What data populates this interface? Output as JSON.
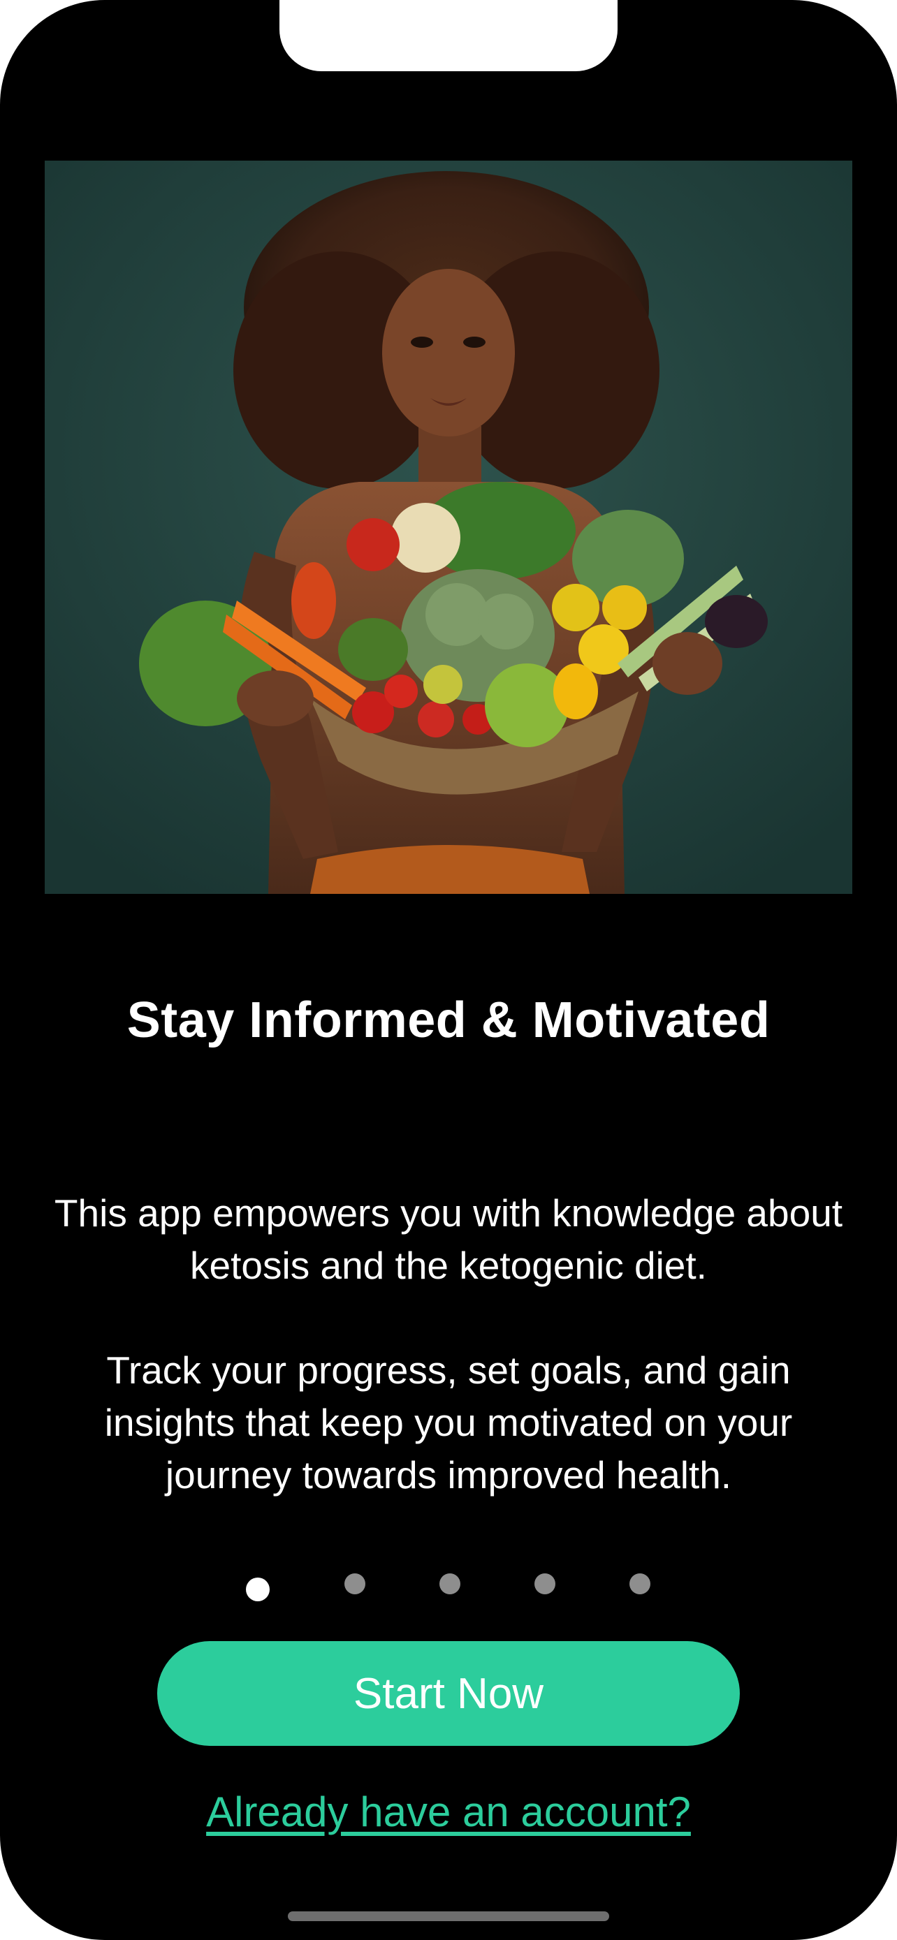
{
  "onboarding": {
    "title": "Stay Informed & Motivated",
    "paragraph_1": "This app empowers you with knowledge about ketosis and the ketogenic diet.",
    "paragraph_2": "Track your progress, set goals, and gain insights that keep you motivated on your journey towards improved health.",
    "page_count": 5,
    "active_page": 1,
    "start_button_label": "Start Now",
    "login_link_label": "Already have an account?"
  },
  "colors": {
    "background": "#000000",
    "accent": "#2ccd9c",
    "dot_inactive": "#8e8e8e",
    "dot_active": "#ffffff",
    "hero_backdrop": "#23423e"
  },
  "hero": {
    "subject": "woman-holding-vegetable-basket-illustration"
  }
}
